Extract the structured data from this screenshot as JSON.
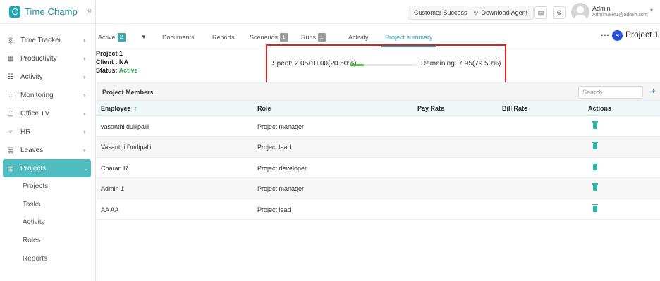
{
  "app": {
    "name": "Time Champ",
    "collapse_icon": "«"
  },
  "sidebar": {
    "items": [
      {
        "label": "Time Tracker",
        "icon": "time-tracker-icon",
        "glyph": "◎"
      },
      {
        "label": "Productivity",
        "icon": "productivity-icon",
        "glyph": "▦"
      },
      {
        "label": "Activity",
        "icon": "activity-icon",
        "glyph": "☷"
      },
      {
        "label": "Monitoring",
        "icon": "monitor-icon",
        "glyph": "▭"
      },
      {
        "label": "Office TV",
        "icon": "tv-icon",
        "glyph": "▢"
      },
      {
        "label": "HR",
        "icon": "hr-icon",
        "glyph": "♀"
      },
      {
        "label": "Leaves",
        "icon": "leaves-icon",
        "glyph": "▤"
      },
      {
        "label": "Projects",
        "icon": "projects-icon",
        "glyph": "▤",
        "active": true
      }
    ],
    "sub_items": [
      "Projects",
      "Tasks",
      "Activity",
      "Roles",
      "Reports"
    ]
  },
  "topbar": {
    "customer_success": "Customer Success",
    "download_agent": "Download Agent",
    "download_icon": "↻",
    "doc_icon": "▤",
    "settings_icon": "⚙",
    "user_name": "Admin",
    "user_email": "Adminuser1@admin.com",
    "user_caret": "▾"
  },
  "tabs": {
    "active_label": "Active",
    "active_count": "2",
    "caret": "▼",
    "documents": "Documents",
    "reports": "Reports",
    "scenarios": "Scenarios",
    "scenarios_count": "1",
    "runs": "Runs",
    "runs_count": "1",
    "activity": "Activity",
    "project_summary": "Project summary",
    "more": "•••",
    "project_badge": "AI",
    "project_title": "Project 1",
    "project_caret": "⌄"
  },
  "project": {
    "title": "Project 1",
    "client_label": "Client : ",
    "client_value": "NA",
    "status_label": "Status: ",
    "status_value": "Active"
  },
  "budget": {
    "spent_text": "Spent:  2.05/10.00(20.50%)",
    "spent_fraction": 0.205,
    "remaining_text": "Remaining:  7.95(79.50%)"
  },
  "members": {
    "title": "Project Members",
    "search_placeholder": "Search",
    "add_icon": "+",
    "columns": {
      "employee": "Employee",
      "sort_icon": "↑",
      "role": "Role",
      "pay_rate": "Pay Rate",
      "bill_rate": "Bill Rate",
      "actions": "Actions"
    },
    "rows": [
      {
        "employee": "vasanthi dullipalli",
        "role": "Project manager",
        "pay_rate": "",
        "bill_rate": ""
      },
      {
        "employee": "Vasanthi Dudipalli",
        "role": "Project lead",
        "pay_rate": "",
        "bill_rate": ""
      },
      {
        "employee": "Charan R",
        "role": "Project developer",
        "pay_rate": "",
        "bill_rate": ""
      },
      {
        "employee": "Admin 1",
        "role": "Project manager",
        "pay_rate": "",
        "bill_rate": ""
      },
      {
        "employee": "AA AA",
        "role": "Project lead",
        "pay_rate": "",
        "bill_rate": ""
      }
    ]
  },
  "colors": {
    "accent": "#2ea5b3",
    "sidebar_active": "#4fbdc0",
    "status_active": "#2fa84f",
    "progress": "#4fc44a",
    "highlight_box": "#e21f1f"
  }
}
